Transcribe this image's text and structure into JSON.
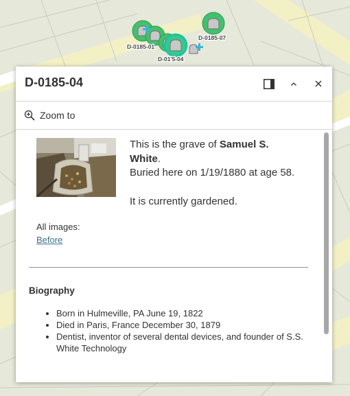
{
  "map": {
    "markers": [
      {
        "label": "D-0185-01"
      },
      {
        "label": "D-0185-07"
      },
      {
        "label": "D-01'5-04"
      }
    ]
  },
  "popup": {
    "title": "D-0185-04",
    "dock_icon": "dock-side-icon",
    "collapse_icon": "chevron-up-icon",
    "close_icon": "close-icon",
    "zoom_label": "Zoom to",
    "zoom_icon": "zoom-in-icon"
  },
  "feature": {
    "intro": "This is the grave of ",
    "name": "Samuel S. White",
    "intro_end": ".",
    "burial": "Buried here on 1/19/1880 at age 58.",
    "status": "It is currently gardened.",
    "all_images_label": "All images:",
    "before_link": "Before",
    "biography_heading": "Biography",
    "biography": [
      "Born in Hulmeville, PA June 19, 1822",
      "Died in Paris, France December 30, 1879",
      "Dentist, inventor of several dental devices, and founder of S.S. White Technology"
    ]
  },
  "colors": {
    "map_bg": "#e8e9dc",
    "road_yellow": "#f4f2c4",
    "marker_green": "#43c06e",
    "marker_selected": "#17c2a8",
    "link_blue": "#3b6f8e"
  }
}
